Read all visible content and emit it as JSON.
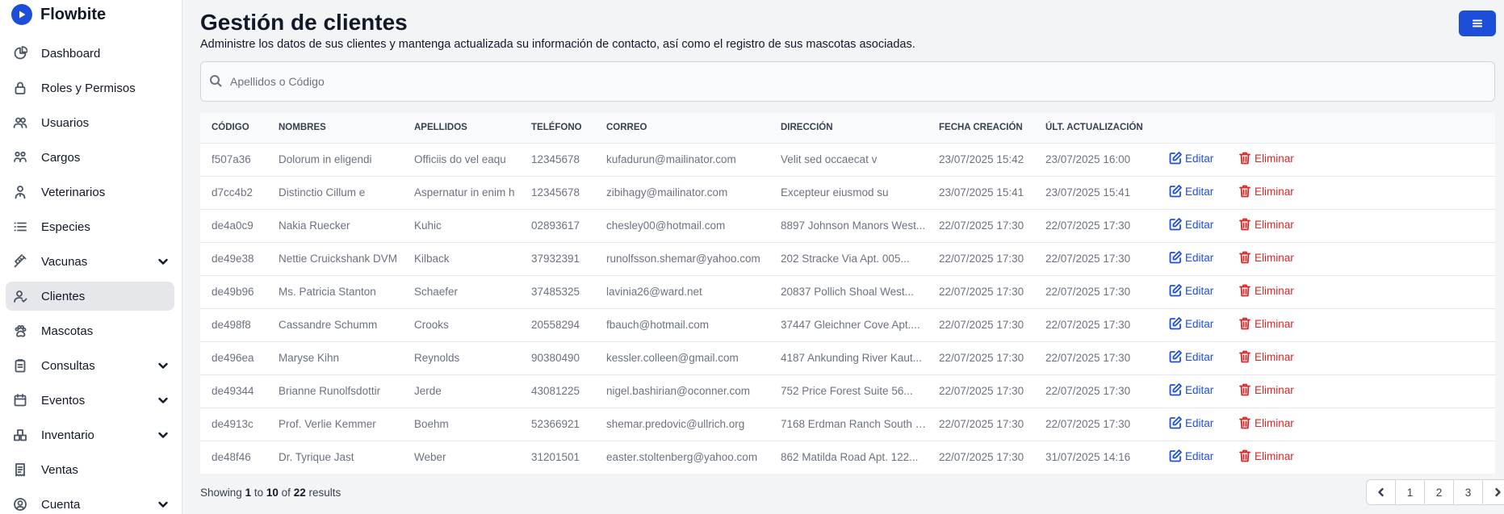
{
  "app": {
    "brand": "Flowbite"
  },
  "sidebar": {
    "items": [
      {
        "label": "Dashboard",
        "icon": "chart-pie-icon",
        "expandable": false,
        "active": false
      },
      {
        "label": "Roles y Permisos",
        "icon": "lock-icon",
        "expandable": false,
        "active": false
      },
      {
        "label": "Usuarios",
        "icon": "users-icon",
        "expandable": false,
        "active": false
      },
      {
        "label": "Cargos",
        "icon": "briefcase-users-icon",
        "expandable": false,
        "active": false
      },
      {
        "label": "Veterinarios",
        "icon": "doctor-icon",
        "expandable": false,
        "active": false
      },
      {
        "label": "Especies",
        "icon": "list-icon",
        "expandable": false,
        "active": false
      },
      {
        "label": "Vacunas",
        "icon": "syringe-icon",
        "expandable": true,
        "active": false
      },
      {
        "label": "Clientes",
        "icon": "user-check-icon",
        "expandable": false,
        "active": true
      },
      {
        "label": "Mascotas",
        "icon": "paw-icon",
        "expandable": false,
        "active": false
      },
      {
        "label": "Consultas",
        "icon": "clipboard-icon",
        "expandable": true,
        "active": false
      },
      {
        "label": "Eventos",
        "icon": "calendar-icon",
        "expandable": true,
        "active": false
      },
      {
        "label": "Inventario",
        "icon": "boxes-icon",
        "expandable": true,
        "active": false
      },
      {
        "label": "Ventas",
        "icon": "receipt-icon",
        "expandable": false,
        "active": false
      },
      {
        "label": "Cuenta",
        "icon": "user-circle-icon",
        "expandable": true,
        "active": false
      }
    ]
  },
  "header": {
    "title": "Gestión de clientes",
    "subtitle": "Administre los datos de sus clientes y mantenga actualizada su información de contacto, así como el registro de sus mascotas asociadas."
  },
  "search": {
    "placeholder": "Apellidos o Código",
    "value": ""
  },
  "table": {
    "columns": [
      "CÓDIGO",
      "NOMBRES",
      "APELLIDOS",
      "TELÉFONO",
      "CORREO",
      "DIRECCIÓN",
      "FECHA CREACIÓN",
      "ÚLT. ACTUALIZACIÓN",
      "",
      ""
    ],
    "edit_label": "Editar",
    "delete_label": "Eliminar",
    "rows": [
      [
        "f507a36",
        "Dolorum in eligendi",
        "Officiis do vel eaqu",
        "12345678",
        "kufadurun@mailinator.com",
        "Velit sed occaecat v",
        "23/07/2025 15:42",
        "23/07/2025 16:00"
      ],
      [
        "d7cc4b2",
        "Distinctio Cillum e",
        "Aspernatur in enim h",
        "12345678",
        "zibihagy@mailinator.com",
        "Excepteur eiusmod su",
        "23/07/2025 15:41",
        "23/07/2025 15:41"
      ],
      [
        "de4a0c9",
        "Nakia Ruecker",
        "Kuhic",
        "02893617",
        "chesley00@hotmail.com",
        "8897 Johnson Manors West...",
        "22/07/2025 17:30",
        "22/07/2025 17:30"
      ],
      [
        "de49e38",
        "Nettie Cruickshank DVM",
        "Kilback",
        "37932391",
        "runolfsson.shemar@yahoo.com",
        "202 Stracke Via Apt. 005...",
        "22/07/2025 17:30",
        "22/07/2025 17:30"
      ],
      [
        "de49b96",
        "Ms. Patricia Stanton",
        "Schaefer",
        "37485325",
        "lavinia26@ward.net",
        "20837 Pollich Shoal West...",
        "22/07/2025 17:30",
        "22/07/2025 17:30"
      ],
      [
        "de498f8",
        "Cassandre Schumm",
        "Crooks",
        "20558294",
        "fbauch@hotmail.com",
        "37447 Gleichner Cove Apt....",
        "22/07/2025 17:30",
        "22/07/2025 17:30"
      ],
      [
        "de496ea",
        "Maryse Kihn",
        "Reynolds",
        "90380490",
        "kessler.colleen@gmail.com",
        "4187 Ankunding River Kaut...",
        "22/07/2025 17:30",
        "22/07/2025 17:30"
      ],
      [
        "de49344",
        "Brianne Runolfsdottir",
        "Jerde",
        "43081225",
        "nigel.bashirian@oconner.com",
        "752 Price Forest Suite 56...",
        "22/07/2025 17:30",
        "22/07/2025 17:30"
      ],
      [
        "de4913c",
        "Prof. Verlie Kemmer",
        "Boehm",
        "52366921",
        "shemar.predovic@ullrich.org",
        "7168 Erdman Ranch South J...",
        "22/07/2025 17:30",
        "22/07/2025 17:30"
      ],
      [
        "de48f46",
        "Dr. Tyrique Jast",
        "Weber",
        "31201501",
        "easter.stoltenberg@yahoo.com",
        "862 Matilda Road Apt. 122...",
        "22/07/2025 17:30",
        "31/07/2025 14:16"
      ]
    ]
  },
  "footer": {
    "showing_prefix": "Showing",
    "from": "1",
    "to_word": "to",
    "to": "10",
    "of_word": "of",
    "total": "22",
    "results_word": "results"
  },
  "pagination": {
    "pages": [
      "1",
      "2",
      "3"
    ],
    "prev_icon": "chevron-left-icon",
    "next_icon": "chevron-right-icon"
  },
  "colors": {
    "primary": "#1d4ed8",
    "danger": "#dc2626",
    "active_nav_bg": "#e5e7eb",
    "page_bg": "#f3f4f6"
  }
}
